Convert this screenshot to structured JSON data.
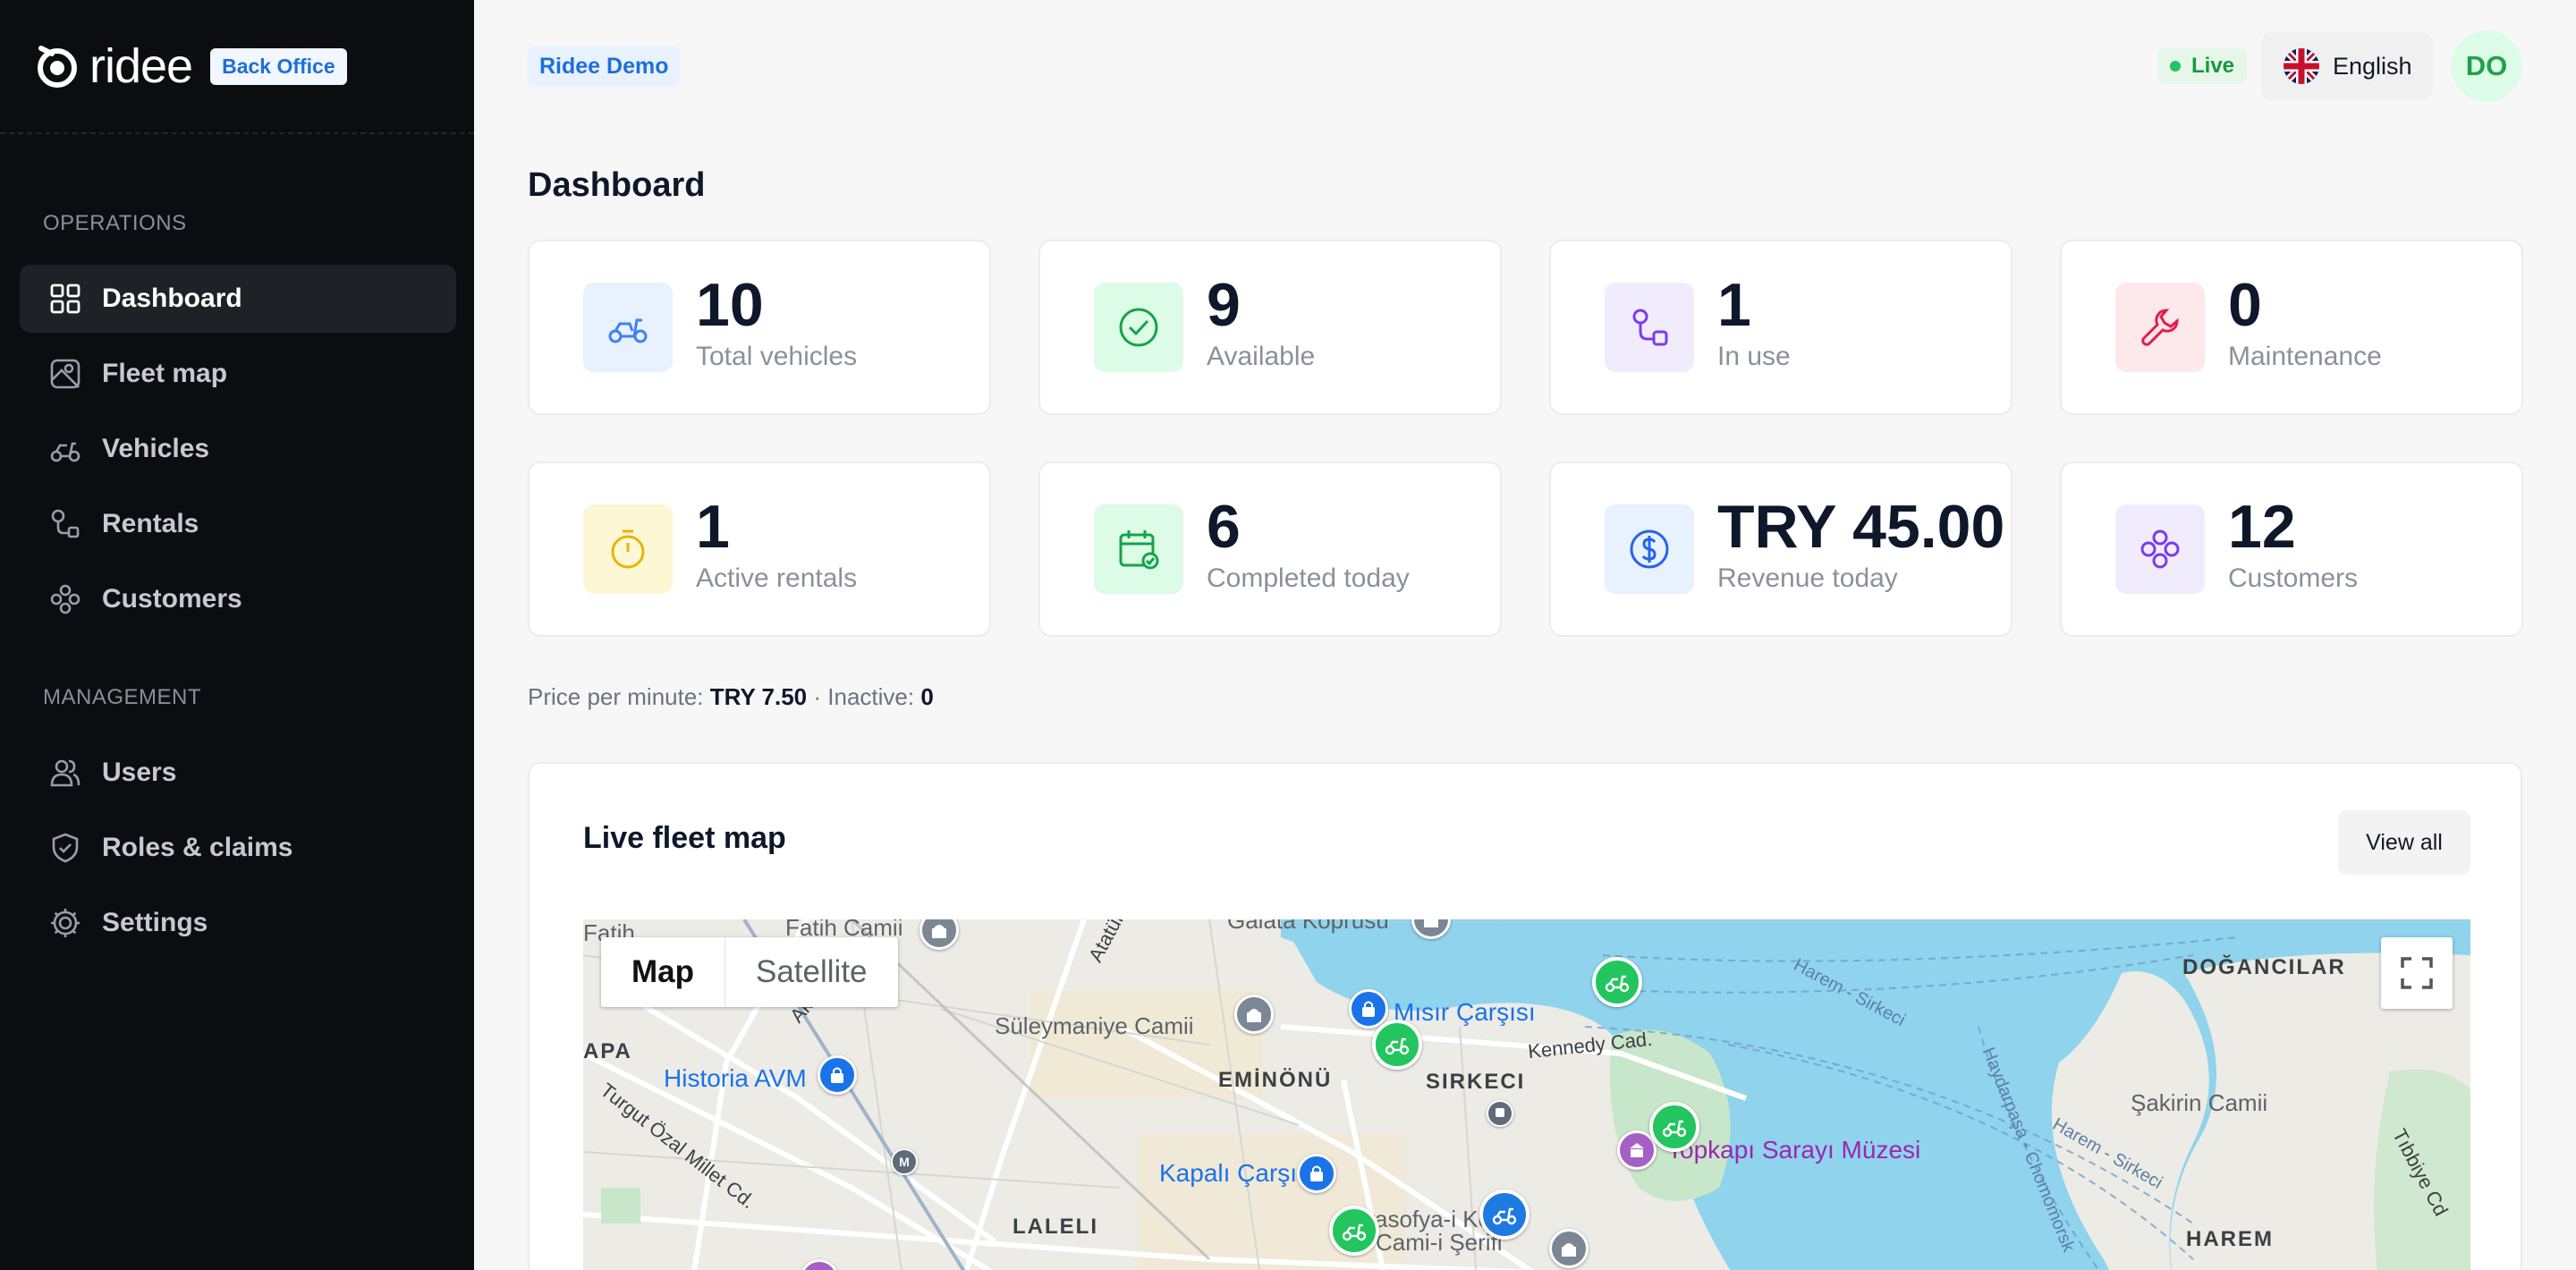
{
  "brand": {
    "name": "ridee",
    "badge": "Back Office"
  },
  "sidebar": {
    "sections": [
      {
        "title": "OPERATIONS"
      },
      {
        "title": "MANAGEMENT"
      }
    ],
    "items": [
      {
        "label": "Dashboard",
        "icon": "grid-icon",
        "active": true
      },
      {
        "label": "Fleet map",
        "icon": "map-icon"
      },
      {
        "label": "Vehicles",
        "icon": "scooter-icon"
      },
      {
        "label": "Rentals",
        "icon": "route-icon"
      },
      {
        "label": "Customers",
        "icon": "customers-icon"
      },
      {
        "label": "Users",
        "icon": "users-icon"
      },
      {
        "label": "Roles & claims",
        "icon": "shield-icon"
      },
      {
        "label": "Settings",
        "icon": "gear-icon"
      }
    ]
  },
  "header": {
    "org": "Ridee Demo",
    "live": "Live",
    "language": "English",
    "avatar": "DO"
  },
  "page": {
    "title": "Dashboard"
  },
  "stats": [
    {
      "value": "10",
      "label": "Total vehicles",
      "icon": "scooter-icon",
      "color": "#3b82f6",
      "bg": "#e8f1fe"
    },
    {
      "value": "9",
      "label": "Available",
      "icon": "check-circle-icon",
      "color": "#16a34a",
      "bg": "#dcfce7"
    },
    {
      "value": "1",
      "label": "In use",
      "icon": "route-icon",
      "color": "#7c3aed",
      "bg": "#f1ecfd"
    },
    {
      "value": "0",
      "label": "Maintenance",
      "icon": "wrench-icon",
      "color": "#e11d48",
      "bg": "#fde8ec"
    },
    {
      "value": "1",
      "label": "Active rentals",
      "icon": "stopwatch-icon",
      "color": "#eab308",
      "bg": "#fef7d6"
    },
    {
      "value": "6",
      "label": "Completed today",
      "icon": "calendar-check-icon",
      "color": "#16a34a",
      "bg": "#dcfce7"
    },
    {
      "value": "TRY 45.00",
      "label": "Revenue today",
      "icon": "dollar-icon",
      "color": "#2563eb",
      "bg": "#e8f1fe"
    },
    {
      "value": "12",
      "label": "Customers",
      "icon": "customers-icon",
      "color": "#7c3aed",
      "bg": "#f1ecfd"
    }
  ],
  "meta": {
    "price_label": "Price per minute: ",
    "price_value": "TRY 7.50",
    "separator": " · Inactive: ",
    "inactive_value": "0"
  },
  "map_card": {
    "title": "Live fleet map",
    "view_all": "View all",
    "map_type_options": [
      "Map",
      "Satellite"
    ],
    "selected_map_type": "Map",
    "places": {
      "fatih": "Fatih",
      "fatih_camii": "Fatih Camii",
      "galata_koprusu": "Galata Köprüsü",
      "ataturk_blv": "Atatürk Blv",
      "suleymaniye": "Süleymaniye Camii",
      "misir_carsisi": "Mısır Çarşısı",
      "kennedy": "Kennedy Cad.",
      "apa": "APA",
      "historia": "Historia AVM",
      "turgut": "Turgut Özal Millet Cd.",
      "eminonu": "EMİNÖNÜ",
      "sirkeci": "SIRKECI",
      "kapali_carsi": "Kapalı Çarşı",
      "laleli": "LALELI",
      "ayasofya": "yasofya-i Kebir",
      "ayasofya2": "Cami-i Şerifi",
      "topkapi": "Topkapı Sarayı Müzesi",
      "dogancilar": "DOĞANCILAR",
      "sakirin": "Şakirin Camii",
      "harem": "HAREM",
      "tibbiye": "Tıbbiye Cd",
      "harem_sirkeci": "Harem - Sirkeci",
      "haydarpasa": "Haydarpaşa - Chomomorsk",
      "harem_sirkeci2": "Harem - Sirkeci",
      "harem_sirkeci3": "Harem - Sirkeci",
      "ak": "Ak"
    }
  }
}
